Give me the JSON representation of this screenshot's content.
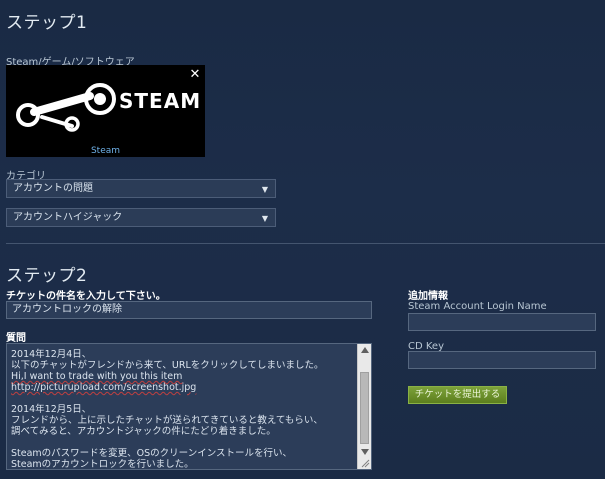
{
  "step1": {
    "title": "ステップ1",
    "game_label": "Steam/ゲーム/ソフトウェア",
    "game_card": {
      "logo_text": "STEAM",
      "caption": "Steam",
      "close_symbol": "✕"
    },
    "category_label": "カテゴリ",
    "category_select": {
      "value": "アカウントの問題",
      "arrow": "▼"
    },
    "subcategory_select": {
      "value": "アカウントハイジャック",
      "arrow": "▼"
    }
  },
  "step2": {
    "title": "ステップ2",
    "subject_label": "チケットの件名を入力して下さい。",
    "subject_value": "アカウントロックの解除",
    "question_label": "質問",
    "question_lines": [
      "2014年12月4日、",
      "以下のチャットがフレンドから来て、URLをクリックしてしまいました。",
      "Hi,I want to trade with you this item",
      "http://picturupload.com/screenshot.jpg",
      "",
      "2014年12月5日、",
      "フレンドから、上に示したチャットが送られてきていると教えてもらい、",
      "調べてみると、アカウントジャックの件にたどり着きました。",
      "",
      "Steamのパスワードを変更、OSのクリーンインストールを行い、",
      "Steamのアカウントロックを行いました。"
    ],
    "extra_label": "追加情報",
    "login_name_label": "Steam Account Login Name",
    "login_name_value": "",
    "cd_key_label": "CD Key",
    "cd_key_value": "",
    "submit_label": "チケットを提出する"
  }
}
